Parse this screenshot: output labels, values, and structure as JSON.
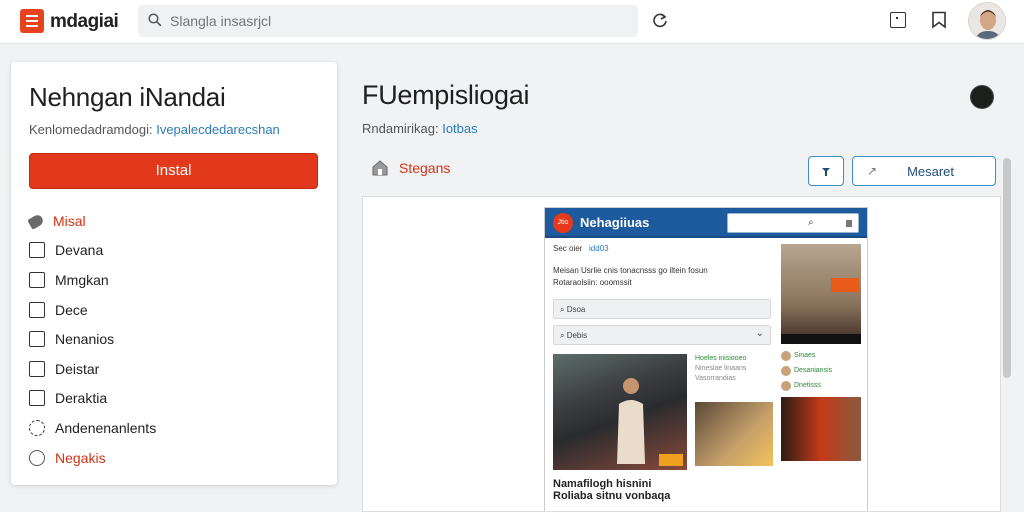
{
  "topbar": {
    "brand": "mdagiai",
    "search_placeholder": "Slangla insasrjcl"
  },
  "left_panel": {
    "title": "Nehngan iNandai",
    "subtitle_label": "Kenlomedadramdogi:",
    "subtitle_link": "Ivepalecdedarecshan",
    "install_button": "Instal",
    "nav_items": [
      {
        "label": "Misal",
        "icon": "tag-icon",
        "accent": true
      },
      {
        "label": "Devana",
        "icon": "checkbox-icon",
        "accent": false
      },
      {
        "label": "Mmgkan",
        "icon": "edit-icon",
        "accent": false
      },
      {
        "label": "Dece",
        "icon": "image-icon",
        "accent": false
      },
      {
        "label": "Nenanios",
        "icon": "document-icon",
        "accent": false
      },
      {
        "label": "Deistar",
        "icon": "square-icon",
        "accent": false
      },
      {
        "label": "Deraktia",
        "icon": "square-icon",
        "accent": false
      },
      {
        "label": "Andenenanlents",
        "icon": "gear-icon",
        "accent": false
      },
      {
        "label": "Negakis",
        "icon": "chat-icon",
        "accent": true
      }
    ]
  },
  "main": {
    "title": "FUempisliogai",
    "subtitle_label": "Rndamirikag:",
    "subtitle_link": "Iotbas",
    "store_label": "Stegans",
    "open_button": "Mesaret"
  },
  "preview": {
    "brand": "Nehagiiuas",
    "logo_text": "Jtio",
    "row1_left": "Sec oier",
    "row1_right": "idd03",
    "row2_line1": "Meisan Usrlie cnis tonacnsss go iltein fosun",
    "row2_line1_highlight": "go iltein fosun",
    "row2_line2": "Rotaraolsiin: ooomssit",
    "search_label": "Dsoa",
    "select_label": "Debis",
    "caption_line1": "Namafilogh hisnini",
    "caption_line2": "Roliaba sitnu vonbaqa",
    "mid_text": [
      "Hoeles inisiooeo",
      "Ninesiae linaans",
      "Vasorrandias"
    ],
    "right_list": [
      "Sinaes",
      "Desaniansis",
      "Dnetisss"
    ]
  },
  "colors": {
    "accent": "#e2391c",
    "link": "#2a7ab8",
    "preview_header": "#1e5a9e"
  }
}
